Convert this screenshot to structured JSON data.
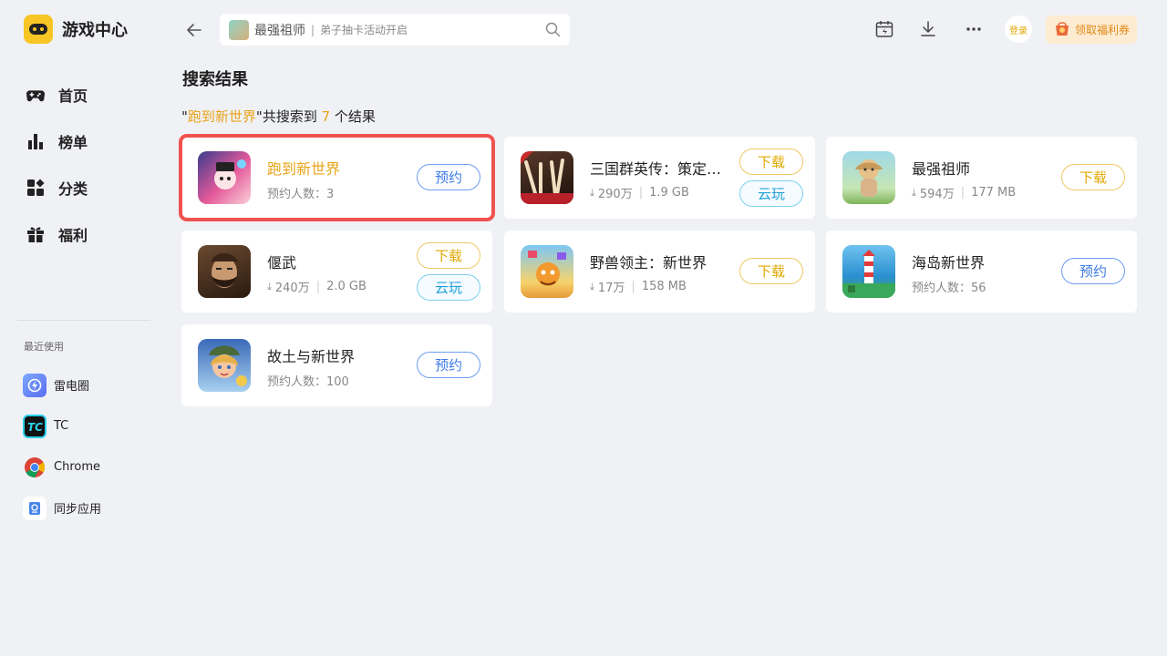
{
  "app": {
    "title": "游戏中心"
  },
  "sidebar": {
    "nav": [
      {
        "label": "首页",
        "icon": "gamepad-icon"
      },
      {
        "label": "榜单",
        "icon": "chart-icon"
      },
      {
        "label": "分类",
        "icon": "category-icon"
      },
      {
        "label": "福利",
        "icon": "gift-icon"
      }
    ],
    "recent_title": "最近使用",
    "recent": [
      {
        "label": "雷电圈",
        "icon": "leidian-icon"
      },
      {
        "label": "TC",
        "icon": "tc-icon"
      },
      {
        "label": "Chrome",
        "icon": "chrome-icon"
      },
      {
        "label": "同步应用",
        "icon": "sync-app-icon"
      }
    ]
  },
  "topbar": {
    "search_main": "最强祖师",
    "search_sub": "弟子抽卡活动开启",
    "login_label": "登录",
    "coupon_label": "领取福利券"
  },
  "main": {
    "title": "搜索结果",
    "summary_prefix": "\"",
    "summary_query": "跑到新世界",
    "summary_mid": "\"共搜索到 ",
    "summary_count": "7",
    "summary_suffix": " 个结果"
  },
  "results": [
    {
      "name": "跑到新世界",
      "meta_text": "预约人数：3",
      "buttons": [
        "预约"
      ],
      "selected": true
    },
    {
      "name": "三国群英传：策定九州",
      "downloads": "290万",
      "size": "1.9 GB",
      "buttons": [
        "下载",
        "云玩"
      ]
    },
    {
      "name": "最强祖师",
      "downloads": "594万",
      "size": "177 MB",
      "buttons": [
        "下载"
      ]
    },
    {
      "name": "偃武",
      "downloads": "240万",
      "size": "2.0 GB",
      "buttons": [
        "下载",
        "云玩"
      ]
    },
    {
      "name": "野兽领主：新世界",
      "downloads": "17万",
      "size": "158 MB",
      "buttons": [
        "下载"
      ]
    },
    {
      "name": "海岛新世界",
      "meta_text": "预约人数：56",
      "buttons": [
        "预约"
      ]
    },
    {
      "name": "故土与新世界",
      "meta_text": "预约人数：100",
      "buttons": [
        "预约"
      ]
    }
  ],
  "colors": {
    "accent": "#e8a317",
    "reserve": "#3d7be8",
    "selection": "#ef5350"
  }
}
